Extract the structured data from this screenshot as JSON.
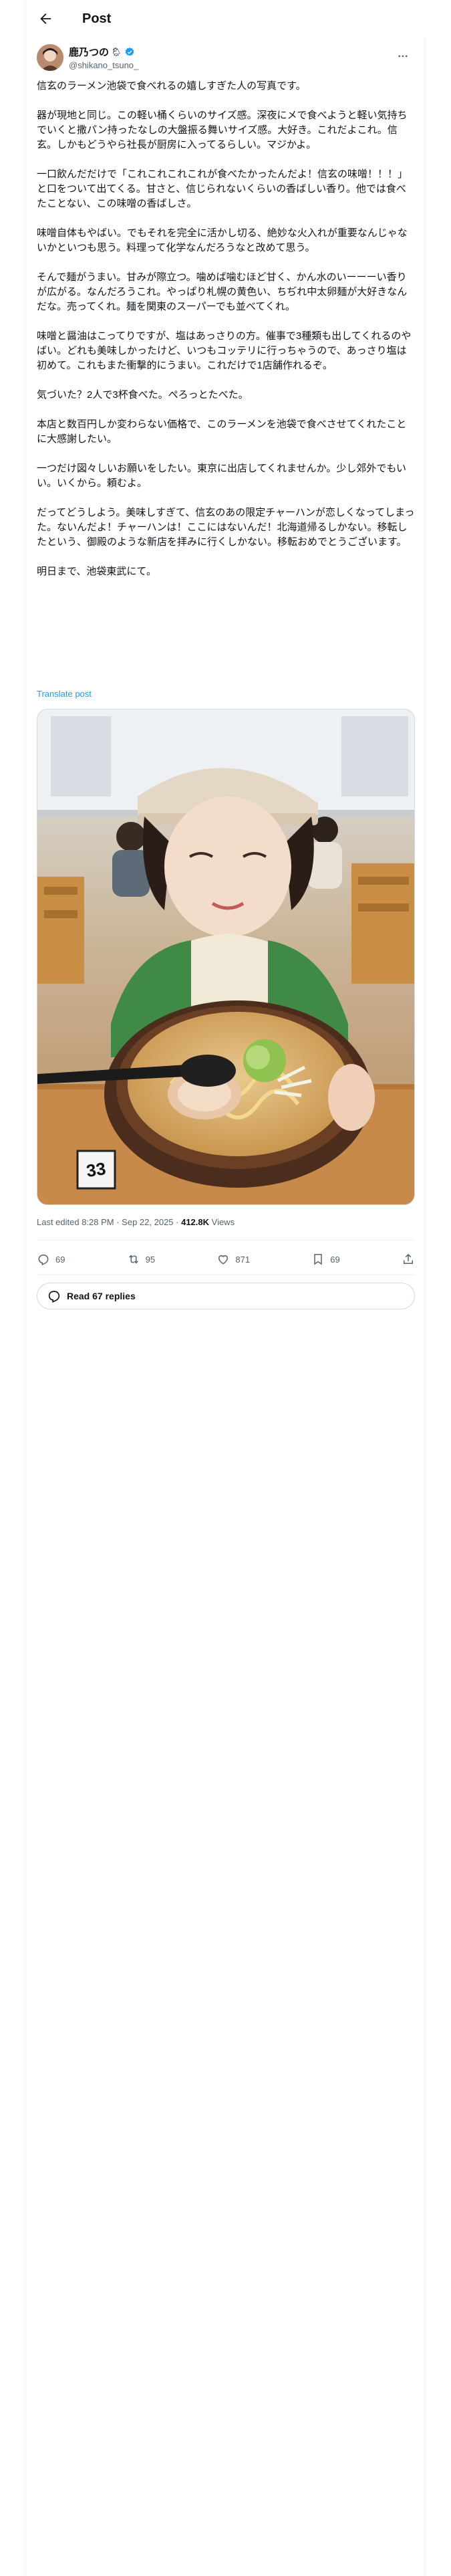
{
  "header": {
    "title": "Post"
  },
  "author": {
    "display_name": "鹿乃つの",
    "emoji": "🌦",
    "handle": "@shikano_tsuno_"
  },
  "post": {
    "paragraphs": [
      "信玄のラーメン池袋で食べれるの嬉しすぎた人の写真です。",
      "器が現地と同じ。この軽い桶くらいのサイズ感。深夜にメで食べようと軽い気持ちでいくと撒パン持ったなしの大盤振る舞いサイズ感。大好き。これだよこれ。信玄。しかもどうやら社長が厨房に入ってるらしい。マジかよ。",
      "一口飲んだだけで「これこれこれこれが食べたかったんだよ！信玄の味噌！！！」と口をついて出てくる。甘さと、信じられないくらいの香ばしい香り。他では食べたことない、この味噌の香ばしさ。",
      "味噌自体もやばい。でもそれを完全に活かし切る、絶妙な火入れが重要なんじゃないかといつも思う。料理って化学なんだろうなと改めて思う。",
      "そんで麺がうまい。甘みが際立つ。噛めば噛むほど甘く、かん水のいーーーい香りが広がる。なんだろうこれ。やっぱり札幌の黄色い、ちぢれ中太卵麺が大好きなんだな。売ってくれ。麺を関東のスーパーでも並べてくれ。",
      "味噌と醤油はこってりですが、塩はあっさりの方。催事で3種類も出してくれるのやばい。どれも美味しかったけど、いつもコッテリに行っちゃうので、あっさり塩は初めて。これもまた衝撃的にうまい。これだけで1店舗作れるぞ。",
      "気づいた？2人で3杯食べた。ぺろっとたべた。",
      "本店と数百円しか変わらない価格で、このラーメンを池袋で食べさせてくれたことに大感謝したい。",
      "一つだけ図々しいお願いをしたい。東京に出店してくれませんか。少し郊外でもいい。いくから。頼むよ。",
      "だってどうしよう。美味しすぎて、信玄のあの限定チャーハンが恋しくなってしまった。ないんだよ！チャーハンは！ここにはないんだ！北海道帰るしかない。移転したという、御殿のような新店を拝みに行くしかない。移転おめでとうございます。",
      "明日まで、池袋東武にて。"
    ],
    "translate_label": "Translate post",
    "photo_table_number": "33"
  },
  "meta": {
    "edited_prefix": "Last edited 8:28 PM · Sep 22, 2025 · ",
    "views_count": "412.8K",
    "views_label": " Views"
  },
  "actions": {
    "replies": "69",
    "reposts": "95",
    "likes": "871",
    "bookmarks": "69"
  },
  "read_replies": "Read 67 replies",
  "colors": {
    "link": "#1d9bf0",
    "secondary_text": "#536471",
    "verified": "#1d9bf0"
  }
}
